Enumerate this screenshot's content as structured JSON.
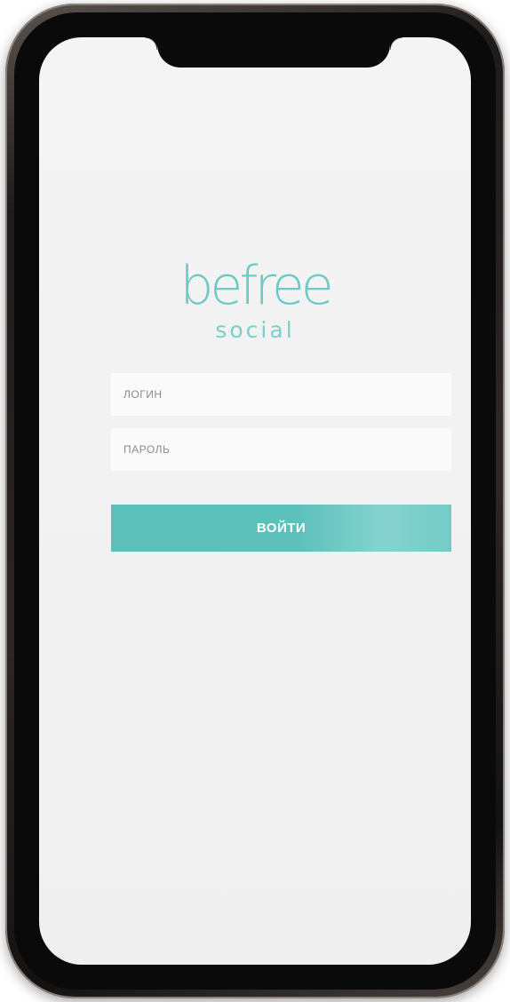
{
  "app": {
    "logo_main": "befree",
    "logo_sub": "social"
  },
  "form": {
    "login_placeholder": "ЛОГИН",
    "login_value": "",
    "password_placeholder": "ПАРОЛЬ",
    "password_value": "",
    "submit_label": "ВОЙТИ"
  },
  "colors": {
    "accent": "#5cc0bb",
    "logo": "#6fc9c4",
    "screen_bg": "#f2f2f2"
  }
}
